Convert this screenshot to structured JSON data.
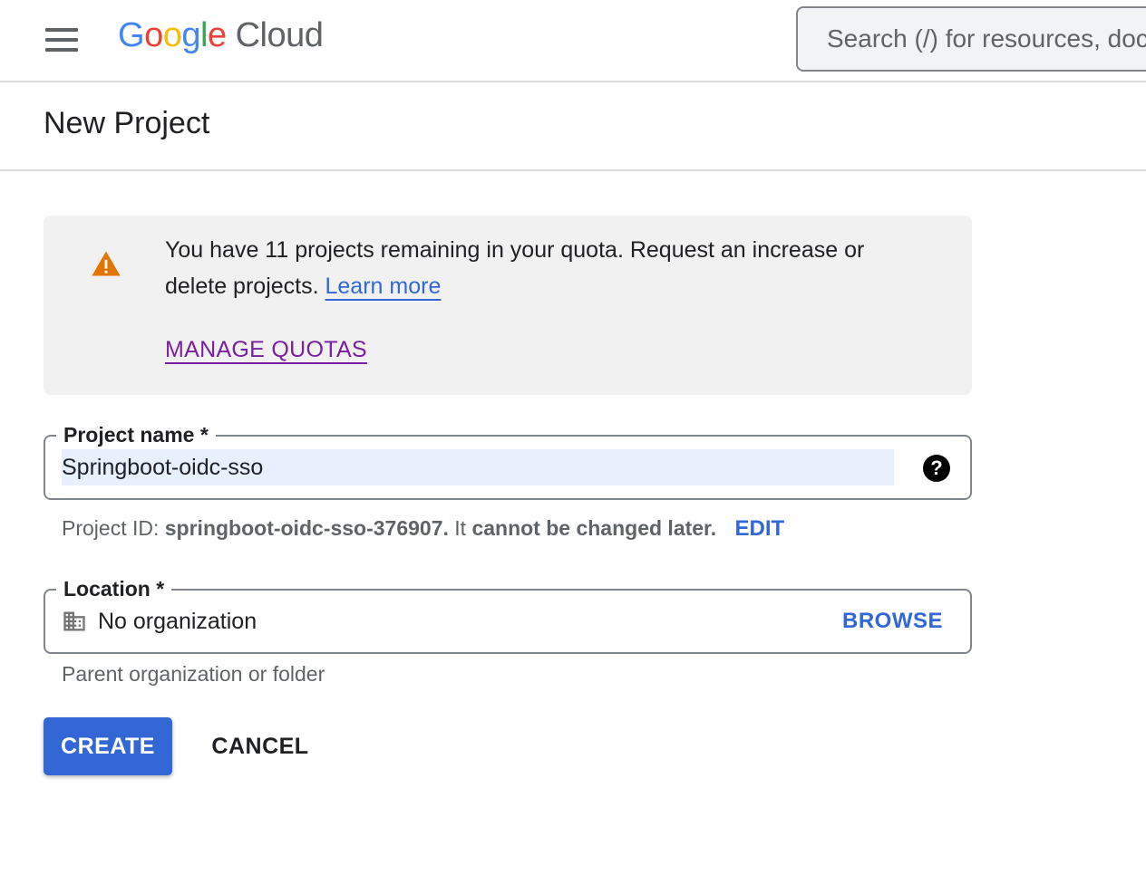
{
  "header": {
    "logo": {
      "letters": [
        "G",
        "o",
        "o",
        "g",
        "l",
        "e"
      ],
      "product": "Cloud"
    },
    "search_placeholder": "Search (/) for resources, docs, products, and more"
  },
  "page": {
    "title": "New Project"
  },
  "banner": {
    "message": "You have 11 projects remaining in your quota. Request an increase or delete projects.",
    "learn_more": "Learn more",
    "manage_quotas": "MANAGE QUOTAS",
    "icon": "warning-icon",
    "icon_color": "#e37400"
  },
  "project_name": {
    "label": "Project name *",
    "value": "Springboot-oidc-sso",
    "help_icon": "help-icon"
  },
  "project_id": {
    "prefix": "Project ID:",
    "id": "springboot-oidc-sso-376907.",
    "middle": "It",
    "suffix": "cannot be changed later.",
    "edit": "EDIT"
  },
  "location": {
    "label": "Location *",
    "value": "No organization",
    "browse": "BROWSE",
    "hint": "Parent organization or folder",
    "icon": "building-icon"
  },
  "actions": {
    "create": "CREATE",
    "cancel": "CANCEL"
  },
  "colors": {
    "primary": "#3367d6",
    "visited_link": "#7b1fa2",
    "banner_bg": "#f1f1f1",
    "autofill_bg": "#e8f0fe"
  }
}
